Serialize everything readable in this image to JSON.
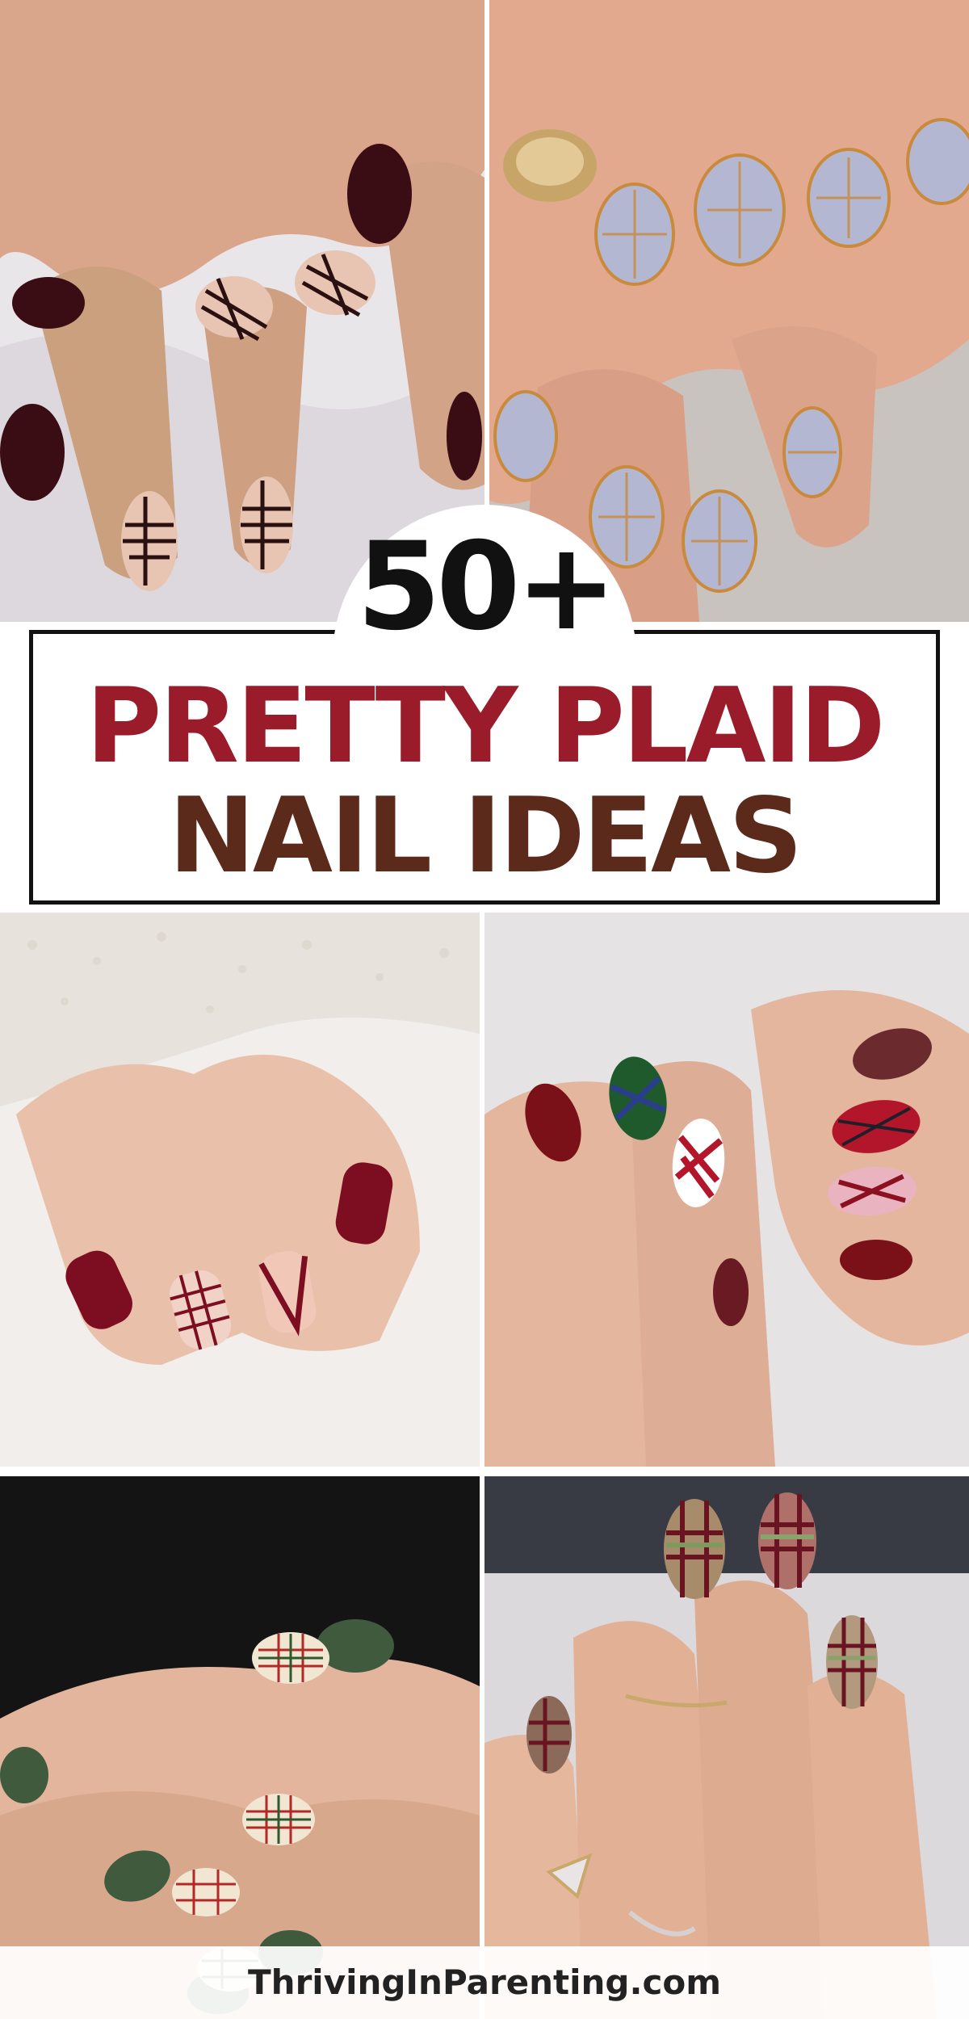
{
  "title": {
    "count": "50+",
    "line1": "PRETTY PLAID",
    "line2": "NAIL IDEAS"
  },
  "footer": {
    "site": "ThrivingInParenting.com"
  },
  "photos": [
    {
      "subject": "burgundy and nude plaid nails on hands over white fabric"
    },
    {
      "subject": "sheer lavender and orange plaid nails with gold ring"
    },
    {
      "subject": "burgundy and nude plaid nails with white knit sweater"
    },
    {
      "subject": "red, green and argyle plaid nails on two hands"
    },
    {
      "subject": "olive green and cream tartan nails on dark background"
    },
    {
      "subject": "sage and maroon plaid almond nails with rings"
    }
  ],
  "colors": {
    "title_red": "#9a1b2a",
    "title_brown": "#5b2a1a",
    "frame": "#111111"
  }
}
